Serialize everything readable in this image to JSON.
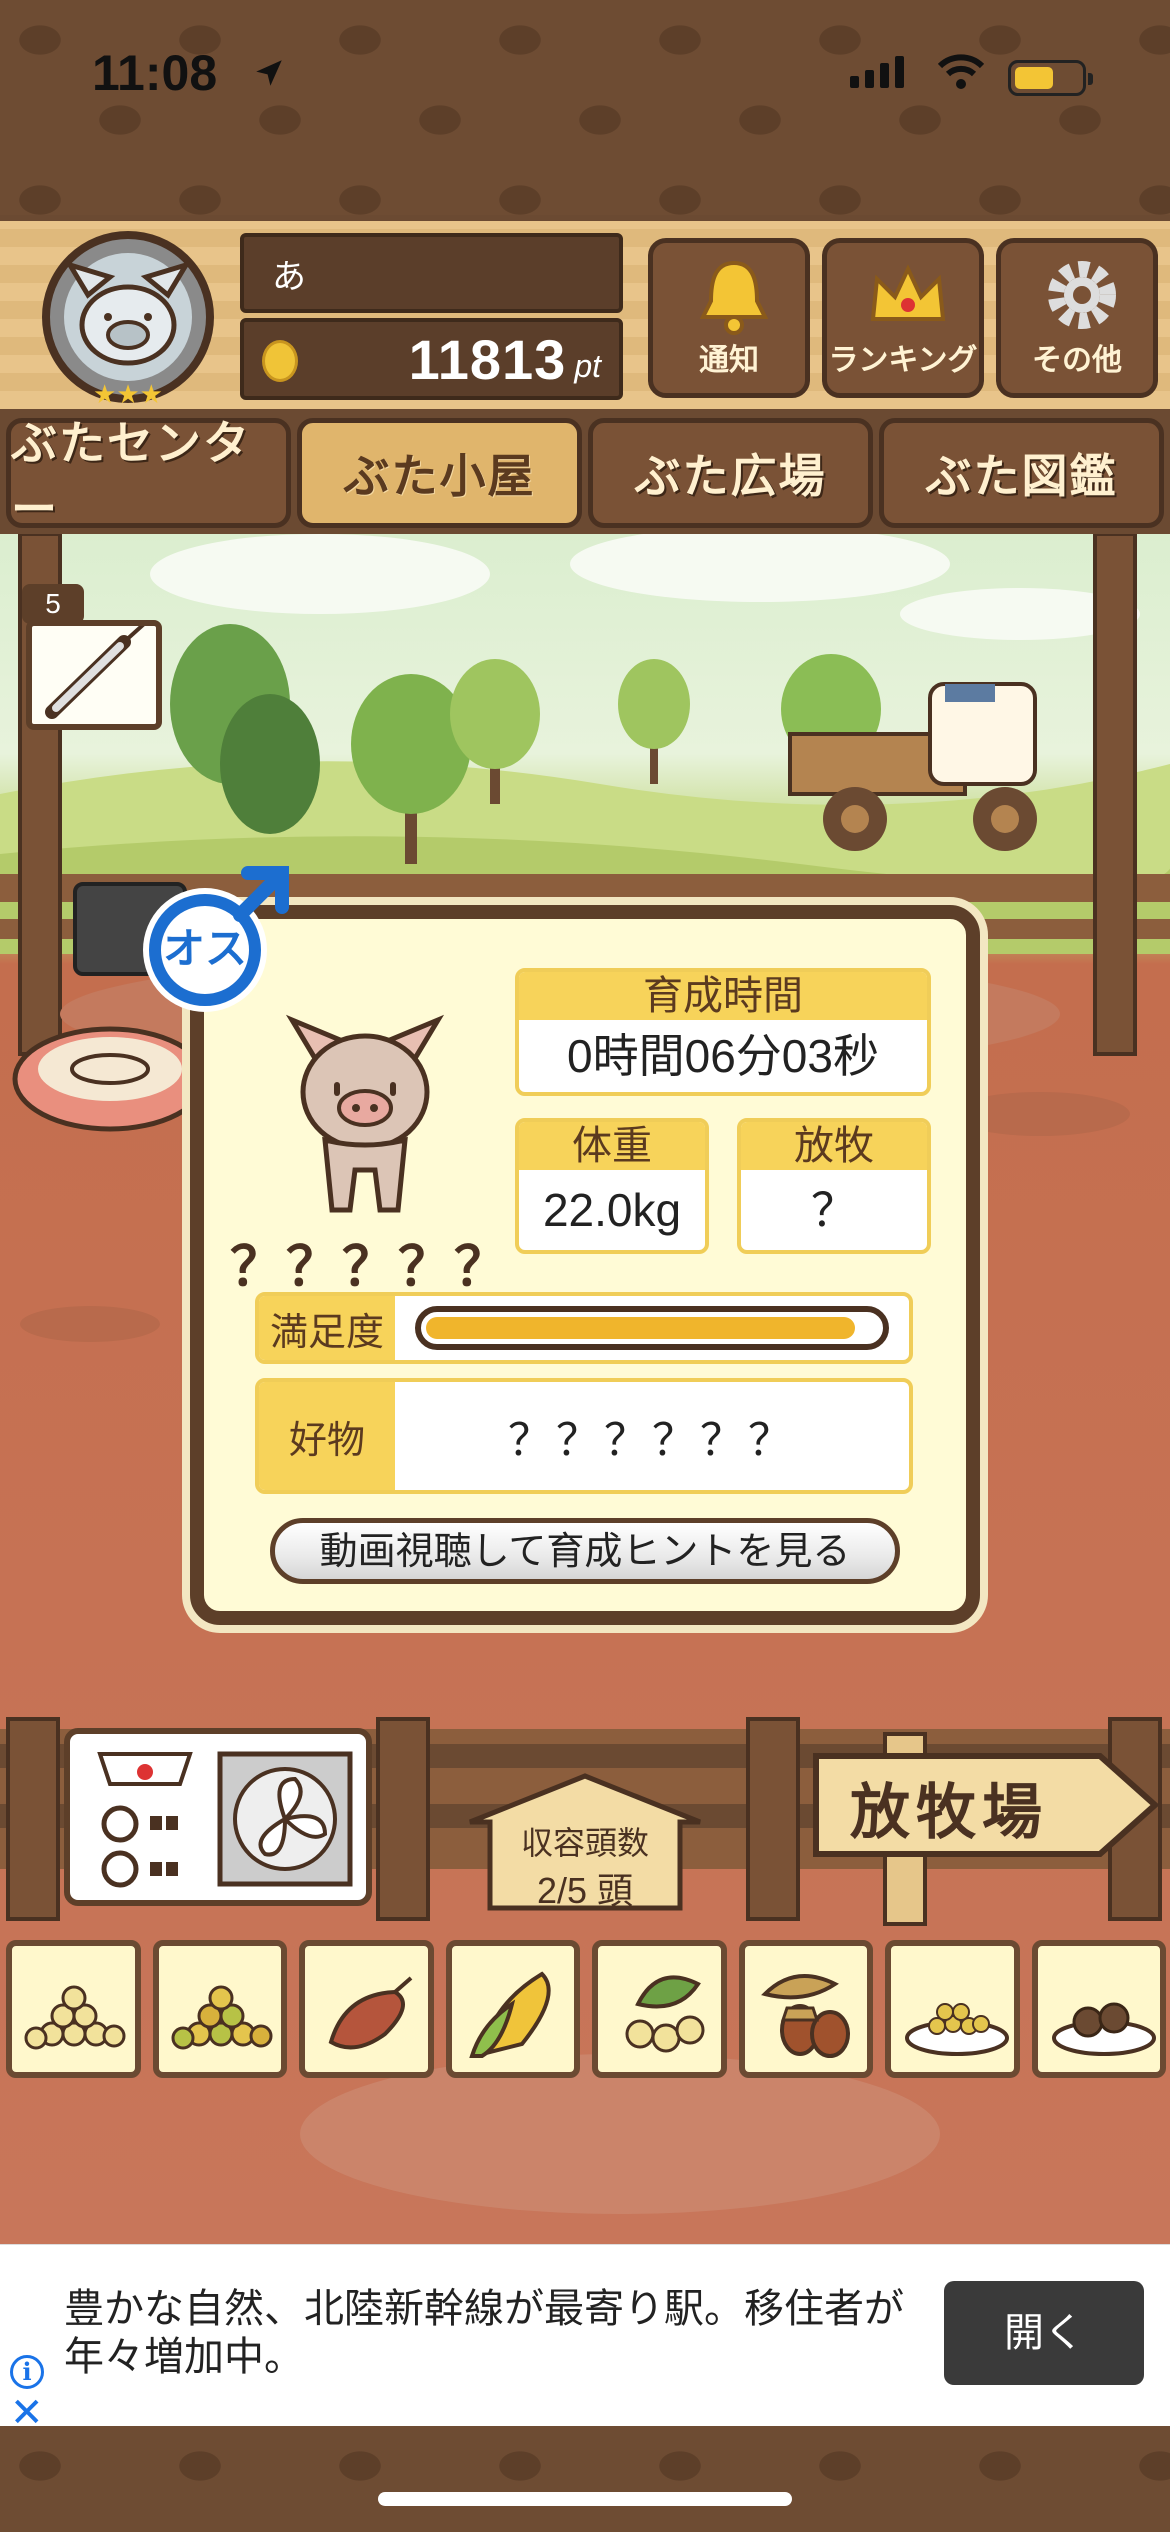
{
  "status_bar": {
    "time": "11:08",
    "battery_level": 0.6
  },
  "header": {
    "player_name": "あ",
    "points": "11813",
    "points_unit": "pt",
    "buttons": [
      {
        "label": "通知",
        "icon": "bell-icon"
      },
      {
        "label": "ランキング",
        "icon": "crown-icon"
      },
      {
        "label": "その他",
        "icon": "gear-icon"
      }
    ]
  },
  "tabs": [
    {
      "label": "ぶたセンター",
      "active": false
    },
    {
      "label": "ぶた小屋",
      "active": true
    },
    {
      "label": "ぶた広場",
      "active": false
    },
    {
      "label": "ぶた図鑑",
      "active": false
    }
  ],
  "item_badge": {
    "count": "5",
    "icon": "syringe-icon"
  },
  "pig_card": {
    "sex_badge": "オス",
    "name": "？？？？？",
    "raising_time_label": "育成時間",
    "raising_time": "0時間06分03秒",
    "weight_label": "体重",
    "weight": "22.0kg",
    "grazing_label": "放牧",
    "grazing": "？",
    "satisfaction_label": "満足度",
    "satisfaction": 0.95,
    "favorite_label": "好物",
    "favorite": "？？？？？？",
    "hint_button": "動画視聴して育成ヒントを見る"
  },
  "capacity": {
    "label": "収容頭数",
    "value": "2/5 頭"
  },
  "pasture_sign": "放牧場",
  "feeds": [
    "soybeans",
    "mixed-grain",
    "sweet-potato",
    "corn",
    "beans",
    "acorn",
    "grain-plate",
    "meatballs"
  ],
  "ad": {
    "text": "豊かな自然、北陸新幹線が最寄り駅。移住者が年々増加中。",
    "button": "開く"
  }
}
